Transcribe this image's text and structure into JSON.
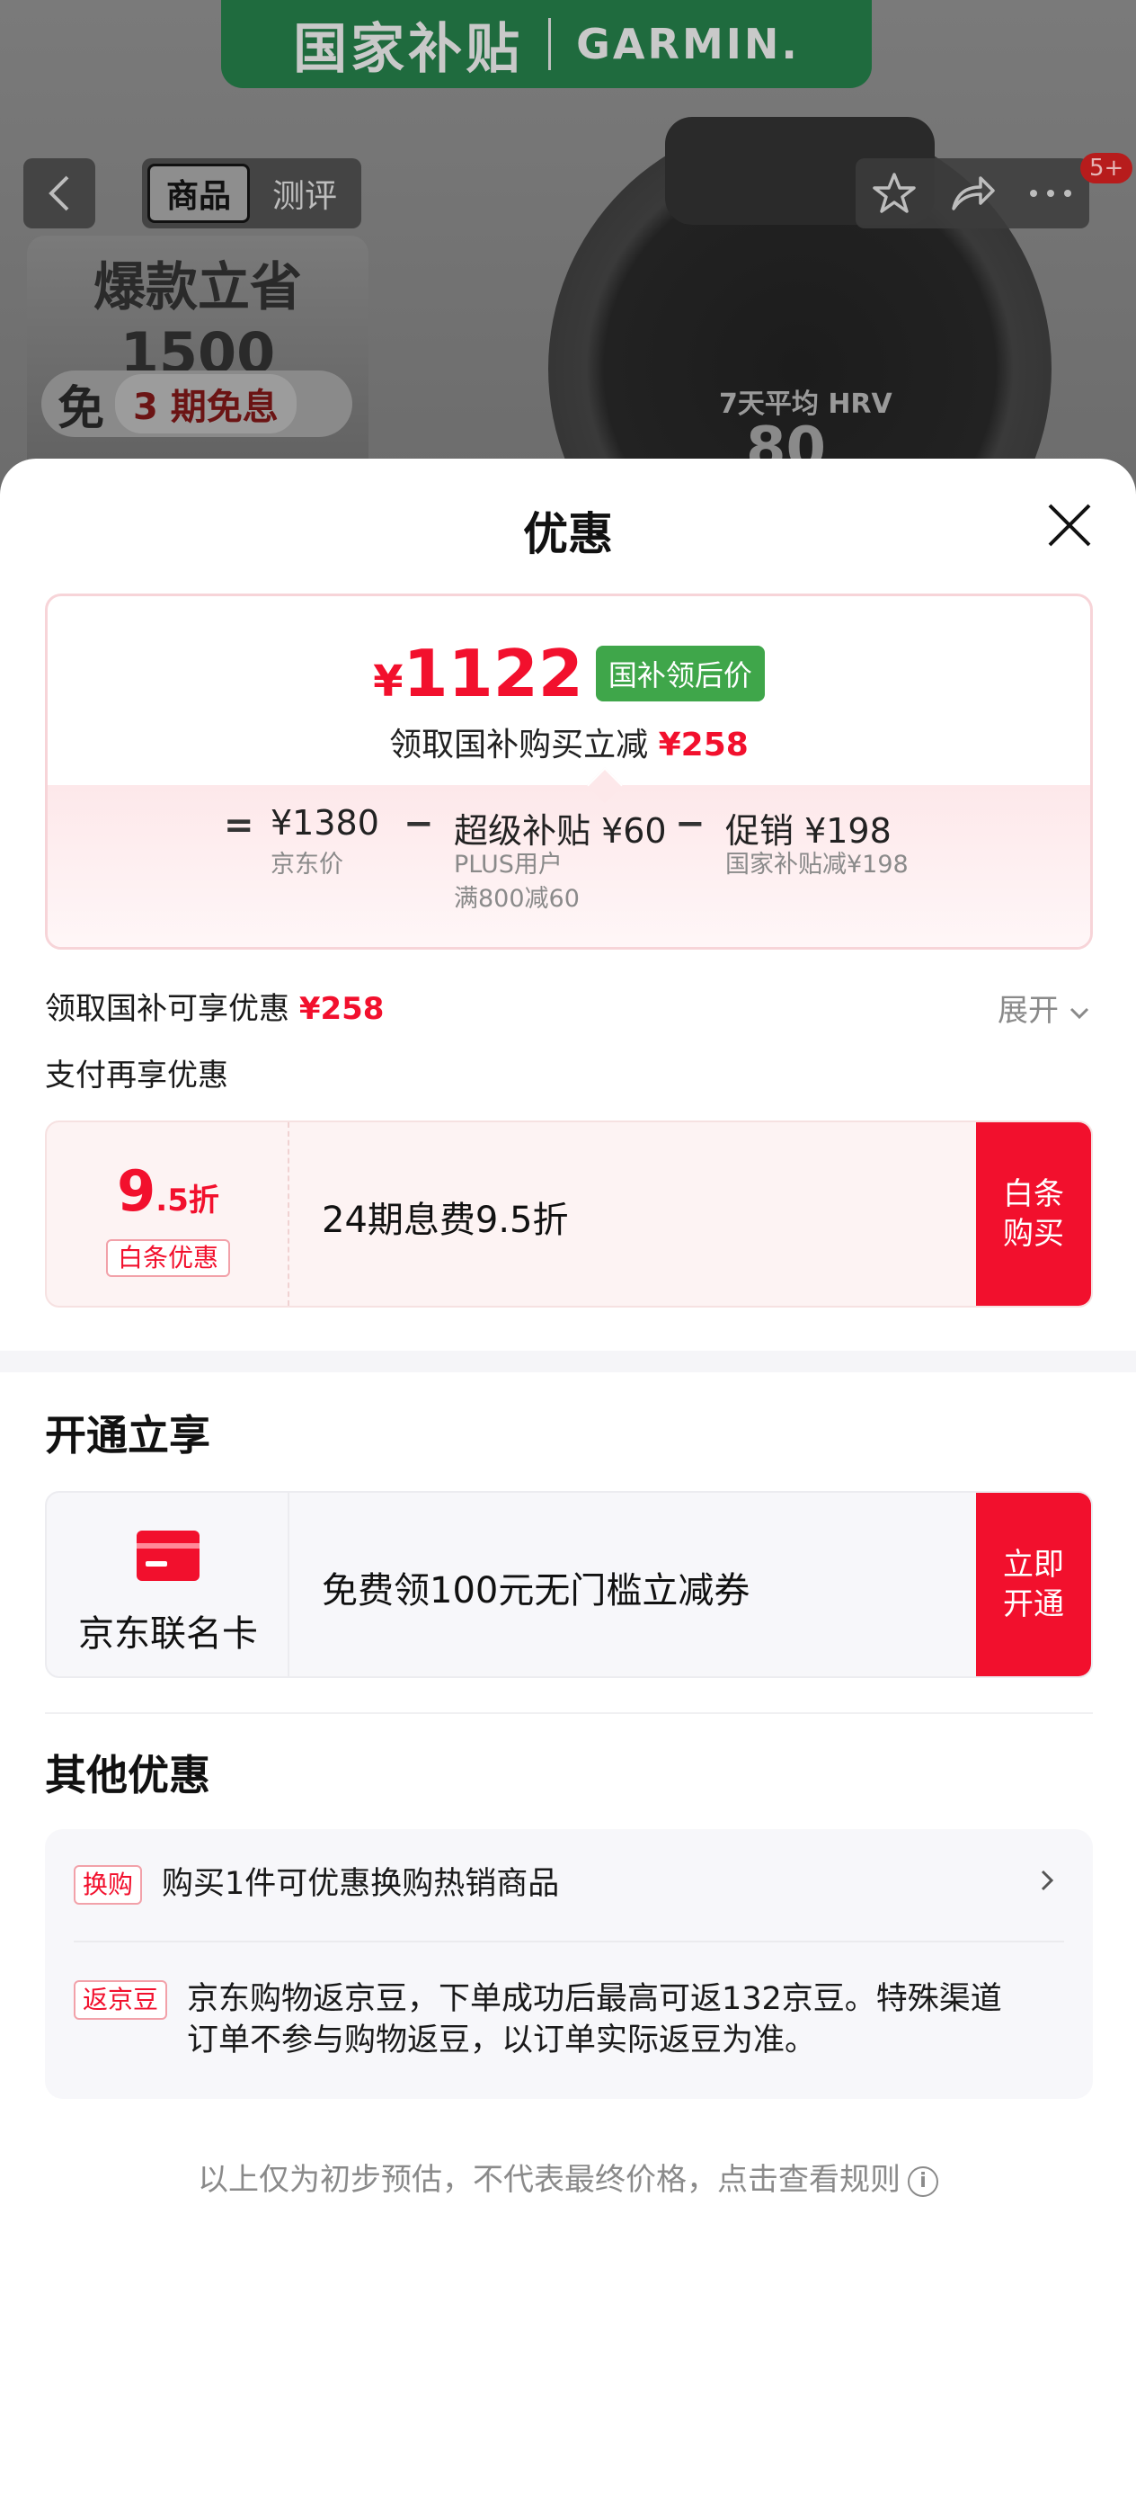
{
  "background": {
    "banner": {
      "left": "国家补贴",
      "right": "GARMIN."
    },
    "tabs": [
      {
        "label": "商品"
      },
      {
        "label": "测评"
      }
    ],
    "cart_badge": "5+",
    "promo": {
      "line1": "爆款立省",
      "line2": "1500",
      "free": "免",
      "installment": "3 期免息"
    },
    "watch": {
      "label": "7天平均 HRV",
      "value": "80"
    }
  },
  "sheet": {
    "title": "优惠",
    "price": {
      "currency": "¥",
      "value": "1122",
      "tag": "国补领后价",
      "subtitle": "领取国补购买立减",
      "subtitle_amount": "¥258"
    },
    "breakdown": {
      "eq": "=",
      "minus": "−",
      "items": [
        {
          "main": "¥1380",
          "sub": "京东价",
          "sub2": ""
        },
        {
          "main": "超级补贴 ¥60",
          "sub": "PLUS用户",
          "sub2": "满800减60"
        },
        {
          "main": "促销 ¥198",
          "sub": "国家补贴减¥198",
          "sub2": ""
        }
      ]
    },
    "gov_subsidy": {
      "label": "领取国补可享优惠",
      "amount": "¥258",
      "expand": "展开"
    },
    "pay_section_title": "支付再享优惠",
    "pay_offer": {
      "discount_big": "9",
      "discount_small": ".5折",
      "tag": "白条优惠",
      "text": "24期息费9.5折",
      "button_line1": "白条",
      "button_line2": "购买"
    },
    "open_section_title": "开通立享",
    "card_offer": {
      "name": "京东联名卡",
      "text": "免费领100元无门槛立减券",
      "button_line1": "立即",
      "button_line2": "开通"
    },
    "other_section_title": "其他优惠",
    "other": [
      {
        "tag": "换购",
        "text": "购买1件可优惠换购热销商品"
      },
      {
        "tag": "返京豆",
        "text_line1": "京东购物返京豆，下单成功后最高可返132京豆。特殊渠道",
        "text_line2": "订单不参与购物返豆，以订单实际返豆为准。"
      }
    ],
    "footnote": "以上仅为初步预估，不代表最终价格，点击查看规则",
    "footnote_icon": "i"
  },
  "colors": {
    "accent": "#f2102d",
    "tag_green": "#3fa64a"
  }
}
